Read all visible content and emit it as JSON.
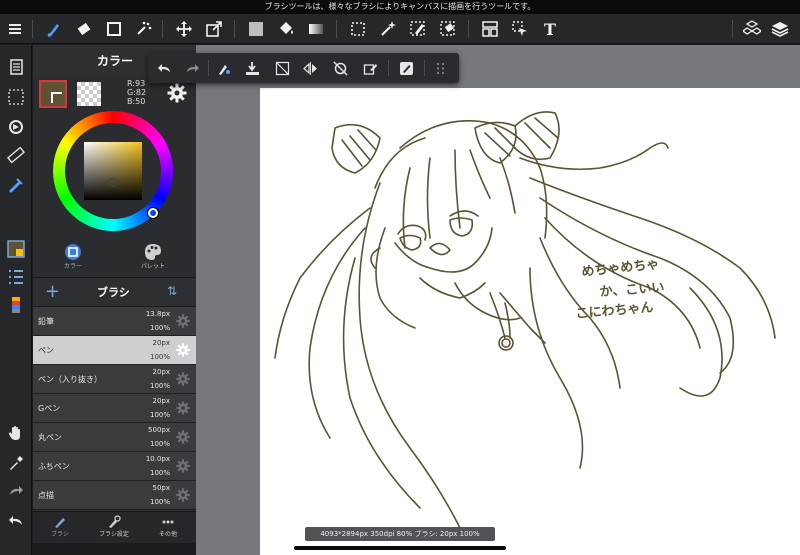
{
  "tooltip": "ブラシツールは、様々なブラシによりキャンバスに描画を行うツールです。",
  "top_toolbar": {
    "menu_icon": "hamburger-menu-icon",
    "tools": [
      "brush-tool-icon",
      "eraser-tool-icon",
      "rectangle-tool-icon",
      "effect-tool-icon",
      "move-tool-icon",
      "transform-tool-icon",
      "fill-color-icon",
      "bucket-tool-icon",
      "gradation-tool-icon",
      "select-tool-icon",
      "magic-wand-icon",
      "select-pen-icon",
      "select-eraser-icon",
      "frame-tool-icon",
      "operation-tool-icon",
      "text-tool-icon"
    ],
    "text_tool_label": "T",
    "right": [
      "material-icon",
      "layer-icon"
    ]
  },
  "floating_toolbar": [
    "undo-icon",
    "redo-icon",
    "clear-icon",
    "fill-icon",
    "deselect-icon",
    "flip-icon",
    "rotate-icon",
    "transform-icon",
    "snap-icon",
    "more-icon"
  ],
  "color_panel": {
    "title": "カラー",
    "main_color": "#5d5232",
    "rgb_r": "R:93",
    "rgb_g": "G:82",
    "rgb_b": "B:50",
    "hue_color": "#f3c11a",
    "mode_color": "カラー",
    "mode_palette": "パレット"
  },
  "brush_panel": {
    "title": "ブラシ",
    "items": [
      {
        "name": "鉛筆",
        "size": "13.8px",
        "opacity": "100%",
        "selected": false
      },
      {
        "name": "ペン",
        "size": "20px",
        "opacity": "100%",
        "selected": true
      },
      {
        "name": "ペン（入り抜き）",
        "size": "20px",
        "opacity": "100%",
        "selected": false
      },
      {
        "name": "Gペン",
        "size": "20px",
        "opacity": "100%",
        "selected": false
      },
      {
        "name": "丸ペン",
        "size": "500px",
        "opacity": "100%",
        "selected": false
      },
      {
        "name": "ふちペン",
        "size": "10.0px",
        "opacity": "100%",
        "selected": false
      },
      {
        "name": "点描",
        "size": "50px",
        "opacity": "100%",
        "selected": false
      }
    ]
  },
  "panel_tabs": {
    "brush": "ブラシ",
    "brush_settings": "ブラシ設定",
    "other": "その他"
  },
  "canvas": {
    "handwriting": [
      "めちゃめちゃ",
      "か、こいい",
      "こにわちゃん"
    ],
    "status": "4093*2894px 350dpi 80% ブラシ: 20px 100%"
  },
  "colors": {
    "ink": "#5d5232",
    "accent": "#7aa6d8",
    "selected_row": "#cfcfd1"
  }
}
